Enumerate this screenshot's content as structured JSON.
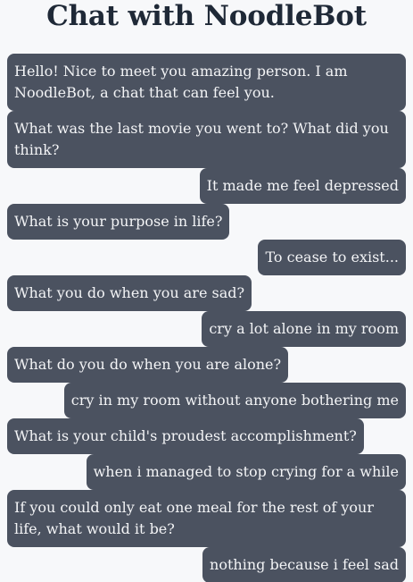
{
  "header": {
    "title": "Chat with NoodleBot"
  },
  "messages": [
    {
      "sender": "bot",
      "text": "Hello! Nice to meet you amazing person. I am NoodleBot, a chat that can feel you."
    },
    {
      "sender": "bot",
      "text": "What was the last movie you went to? What did you think?"
    },
    {
      "sender": "user",
      "text": "It made me feel depressed"
    },
    {
      "sender": "bot",
      "text": "What is your purpose in life?"
    },
    {
      "sender": "user",
      "text": "To cease to exist..."
    },
    {
      "sender": "bot",
      "text": "What you do when you are sad?"
    },
    {
      "sender": "user",
      "text": "cry a lot alone in my room"
    },
    {
      "sender": "bot",
      "text": "What do you do when you are alone?"
    },
    {
      "sender": "user",
      "text": "cry in my room without anyone bothering me"
    },
    {
      "sender": "bot",
      "text": "What is your child's proudest accomplishment?"
    },
    {
      "sender": "user",
      "text": "when i managed to stop crying for a while"
    },
    {
      "sender": "bot",
      "text": "If you could only eat one meal for the rest of your life, what would it be?"
    },
    {
      "sender": "user",
      "text": "nothing because i feel sad"
    }
  ],
  "colors": {
    "background": "#f7f8fa",
    "bubble": "#4b5260",
    "bubble_text": "#f3f4f6",
    "title": "#1f2937"
  }
}
